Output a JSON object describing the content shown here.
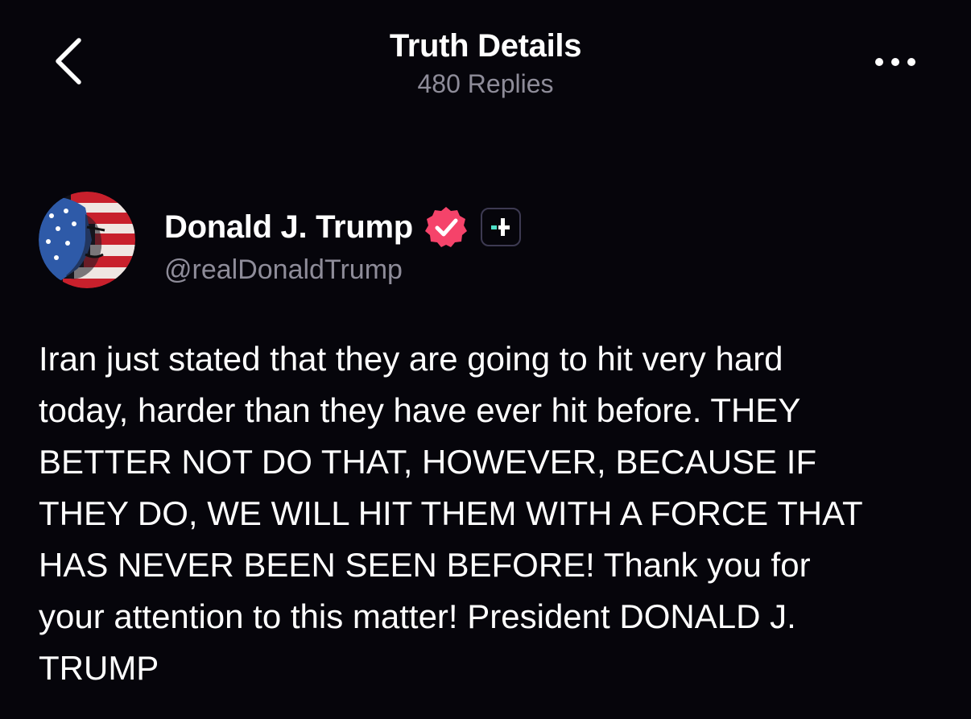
{
  "header": {
    "title": "Truth Details",
    "subtitle": "480 Replies",
    "back_icon": "chevron-left-icon",
    "more_icon": "more-horizontal-icon"
  },
  "author": {
    "name": "Donald J. Trump",
    "handle": "@realDonaldTrump",
    "verified_icon": "verified-badge-icon",
    "plus_badge_icon": "truth-plus-icon"
  },
  "post": {
    "text": "Iran just stated that they are going to hit very hard\ntoday, harder than they have ever hit before. THEY\nBETTER NOT DO THAT, HOWEVER, BECAUSE IF\nTHEY DO, WE WILL HIT THEM WITH A FORCE THAT\nHAS NEVER BEEN SEEN BEFORE! Thank you for\nyour attention to this matter! President DONALD J.\nTRUMP"
  },
  "colors": {
    "background": "#06050b",
    "muted_text": "#8e8c99",
    "verified_pink": "#f5436a",
    "plus_teal": "#4fe0c8",
    "badge_border": "#3d3a52"
  }
}
